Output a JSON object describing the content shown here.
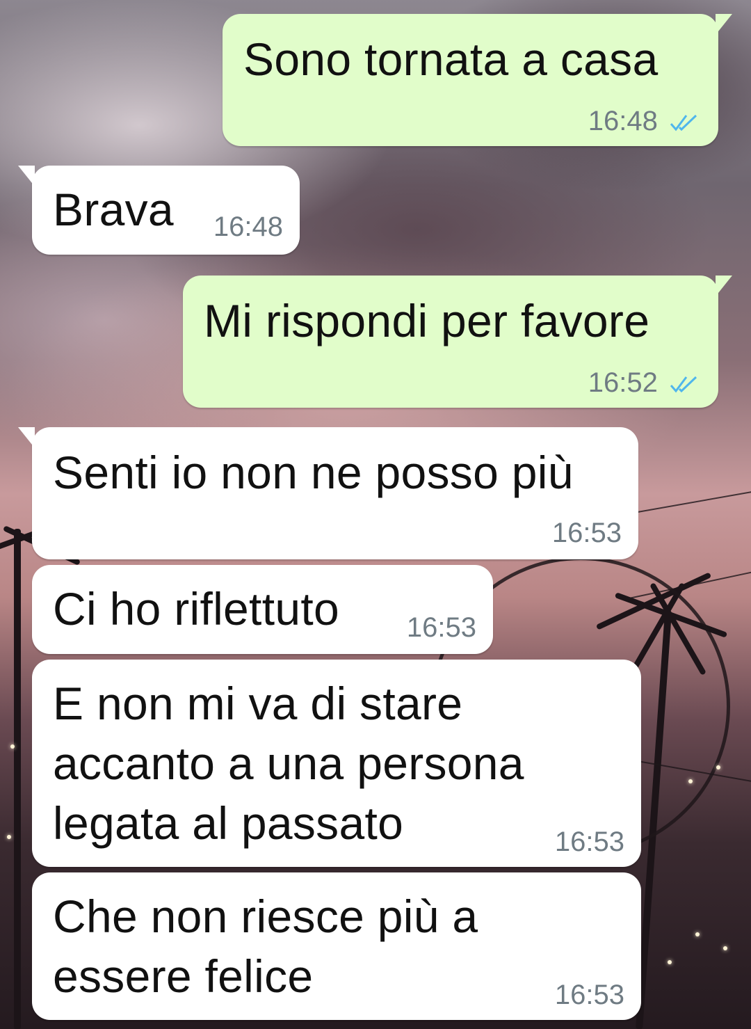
{
  "colors": {
    "outgoing_bubble": "#e1fdca",
    "incoming_bubble": "#ffffff",
    "timestamp": "#6f7b83",
    "read_receipt": "#4fb6ec"
  },
  "messages": [
    {
      "direction": "outgoing",
      "text": "Sono tornata a casa",
      "time": "16:48",
      "status_icon": "double-check-read-icon"
    },
    {
      "direction": "incoming",
      "text": "Brava",
      "time": "16:48"
    },
    {
      "direction": "outgoing",
      "text": "Mi rispondi per favore",
      "time": "16:52",
      "status_icon": "double-check-read-icon"
    },
    {
      "direction": "incoming",
      "text": "Senti io non ne posso più",
      "time": "16:53"
    },
    {
      "direction": "incoming",
      "text": "Ci ho riflettuto",
      "time": "16:53"
    },
    {
      "direction": "incoming",
      "text": "E non mi va di stare\naccanto a una persona\nlegata al passato",
      "time": "16:53"
    },
    {
      "direction": "incoming",
      "text": "Che non riesce più a\nessere felice",
      "time": "16:53"
    }
  ]
}
